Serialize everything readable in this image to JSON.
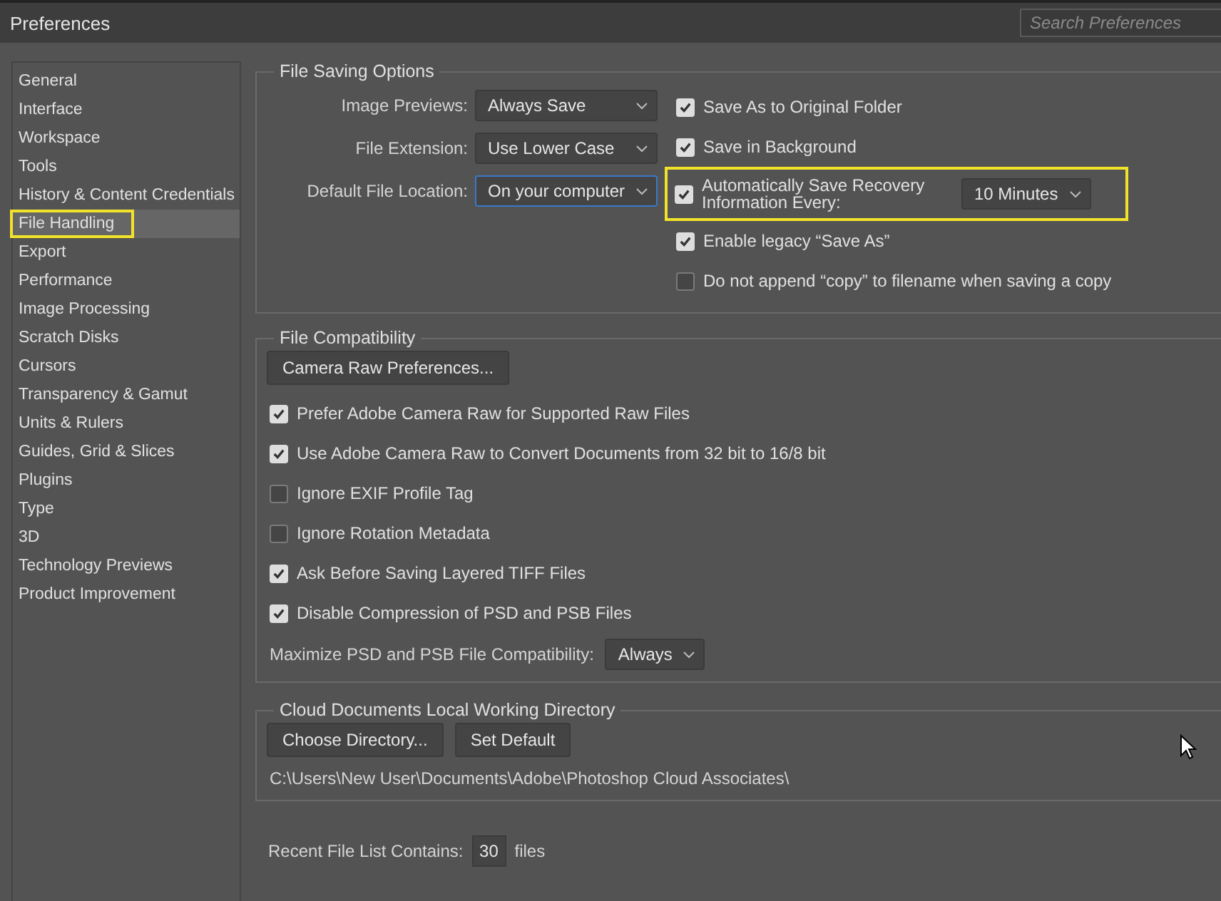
{
  "window": {
    "title": "Preferences"
  },
  "search": {
    "placeholder": "Search Preferences"
  },
  "sidebar": {
    "items": [
      {
        "label": "General",
        "selected": false,
        "highlighted": false
      },
      {
        "label": "Interface",
        "selected": false,
        "highlighted": false
      },
      {
        "label": "Workspace",
        "selected": false,
        "highlighted": false
      },
      {
        "label": "Tools",
        "selected": false,
        "highlighted": false
      },
      {
        "label": "History & Content Credentials",
        "selected": false,
        "highlighted": false
      },
      {
        "label": "File Handling",
        "selected": true,
        "highlighted": true
      },
      {
        "label": "Export",
        "selected": false,
        "highlighted": false
      },
      {
        "label": "Performance",
        "selected": false,
        "highlighted": false
      },
      {
        "label": "Image Processing",
        "selected": false,
        "highlighted": false
      },
      {
        "label": "Scratch Disks",
        "selected": false,
        "highlighted": false
      },
      {
        "label": "Cursors",
        "selected": false,
        "highlighted": false
      },
      {
        "label": "Transparency & Gamut",
        "selected": false,
        "highlighted": false
      },
      {
        "label": "Units & Rulers",
        "selected": false,
        "highlighted": false
      },
      {
        "label": "Guides, Grid & Slices",
        "selected": false,
        "highlighted": false
      },
      {
        "label": "Plugins",
        "selected": false,
        "highlighted": false
      },
      {
        "label": "Type",
        "selected": false,
        "highlighted": false
      },
      {
        "label": "3D",
        "selected": false,
        "highlighted": false
      },
      {
        "label": "Technology Previews",
        "selected": false,
        "highlighted": false
      },
      {
        "label": "Product Improvement",
        "selected": false,
        "highlighted": false
      }
    ]
  },
  "file_saving": {
    "title": "File Saving Options",
    "fields": [
      {
        "label": "Image Previews:",
        "value": "Always Save",
        "focused": false
      },
      {
        "label": "File Extension:",
        "value": "Use Lower Case",
        "focused": false
      },
      {
        "label": "Default File Location:",
        "value": "On your computer",
        "focused": true
      }
    ],
    "options": [
      {
        "label": "Save As to Original Folder",
        "checked": true
      },
      {
        "label": "Save in Background",
        "checked": true
      },
      {
        "label": "Automatically Save Recovery Information Every:",
        "checked": true,
        "highlighted": true,
        "dropdown": "10 Minutes"
      },
      {
        "label": "Enable legacy “Save As”",
        "checked": true
      },
      {
        "label": "Do not append “copy” to filename when saving a copy",
        "checked": false
      }
    ]
  },
  "file_compatibility": {
    "title": "File Compatibility",
    "button": "Camera Raw Preferences...",
    "options": [
      {
        "label": "Prefer Adobe Camera Raw for Supported Raw Files",
        "checked": true
      },
      {
        "label": "Use Adobe Camera Raw to Convert Documents from 32 bit to 16/8 bit",
        "checked": true
      },
      {
        "label": "Ignore EXIF Profile Tag",
        "checked": false
      },
      {
        "label": "Ignore Rotation Metadata",
        "checked": false
      },
      {
        "label": "Ask Before Saving Layered TIFF Files",
        "checked": true
      },
      {
        "label": "Disable Compression of PSD and PSB Files",
        "checked": true
      }
    ],
    "maximize": {
      "label": "Maximize PSD and PSB File Compatibility:",
      "value": "Always"
    }
  },
  "cloud": {
    "title": "Cloud Documents Local Working Directory",
    "buttons": [
      "Choose Directory...",
      "Set Default"
    ],
    "path": "C:\\Users\\New User\\Documents\\Adobe\\Photoshop Cloud Associates\\"
  },
  "recent": {
    "label": "Recent File List Contains:",
    "value": "30",
    "unit": "files"
  }
}
